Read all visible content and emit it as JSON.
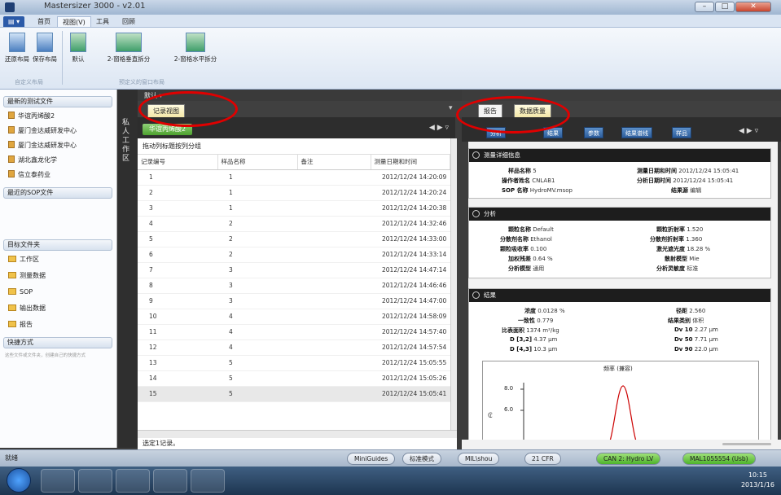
{
  "window": {
    "title": "Mastersizer 3000 - v2.01"
  },
  "ribbon_tabs": [
    "首页",
    "视图(V)",
    "工具",
    "回顾"
  ],
  "ribbon_menu_label": "▤ ▾",
  "ribbon": {
    "buttons": [
      "还原布局",
      "保存布局",
      "默认",
      "2-窗格垂直拆分",
      "2-窗格水平拆分"
    ],
    "groups": [
      "自定义布局",
      "预定义的窗口布局"
    ]
  },
  "left_pane": {
    "recent_tests_header": "最新的测试文件",
    "recent_tests": [
      "华谊丙烯酸2",
      "厦门金达威研发中心",
      "厦门金达威研发中心",
      "湖北鑫龙化学",
      "信立泰药业"
    ],
    "recent_sop_header": "最近的SOP文件",
    "target_folder_header": "目标文件夹",
    "folders": [
      "工作区",
      "测量数据",
      "SOP",
      "输出数据",
      "报告"
    ],
    "shortcuts_header": "快捷方式",
    "shortcuts_note": "这些文件或文件夹，创建自己的快捷方式"
  },
  "workspace_vertical": "私人工作区",
  "mid": {
    "top_label": "默认 ▾",
    "view_tab": "记录视图",
    "file_tab": "华谊丙烯酸2",
    "nav": "◀ ▶ ▿",
    "group_hint": "拖动列标题按列分组",
    "columns": [
      "记录编号",
      "样品名称",
      "备注",
      "测量日期和时间"
    ],
    "rows": [
      [
        "1",
        "1",
        "",
        "2012/12/24 14:20:09"
      ],
      [
        "2",
        "1",
        "",
        "2012/12/24 14:20:24"
      ],
      [
        "3",
        "1",
        "",
        "2012/12/24 14:20:38"
      ],
      [
        "4",
        "2",
        "",
        "2012/12/24 14:32:46"
      ],
      [
        "5",
        "2",
        "",
        "2012/12/24 14:33:00"
      ],
      [
        "6",
        "2",
        "",
        "2012/12/24 14:33:14"
      ],
      [
        "7",
        "3",
        "",
        "2012/12/24 14:47:14"
      ],
      [
        "8",
        "3",
        "",
        "2012/12/24 14:46:46"
      ],
      [
        "9",
        "3",
        "",
        "2012/12/24 14:47:00"
      ],
      [
        "10",
        "4",
        "",
        "2012/12/24 14:58:09"
      ],
      [
        "11",
        "4",
        "",
        "2012/12/24 14:57:40"
      ],
      [
        "12",
        "4",
        "",
        "2012/12/24 14:57:54"
      ],
      [
        "13",
        "5",
        "",
        "2012/12/24 15:05:55"
      ],
      [
        "14",
        "5",
        "",
        "2012/12/24 15:05:26"
      ],
      [
        "15",
        "5",
        "",
        "2012/12/24 15:05:41"
      ]
    ],
    "selected_row": 14,
    "selection_note": "选定1记录。"
  },
  "right": {
    "tabs": [
      "报告",
      "数据质量"
    ],
    "tools": [
      "分析",
      "结果",
      "参数",
      "结果谱线",
      "样品"
    ],
    "sections": {
      "measurement": {
        "title": "测量详细信息",
        "sample_name_label": "样品名称",
        "sample_name": "5",
        "operator_label": "操作者姓名",
        "operator": "CNLAB1",
        "sop_label": "SOP 名称",
        "sop": "HydroMV.msop",
        "meas_time_label": "测量日期和时间",
        "meas_time": "2012/12/24 15:05:41",
        "analysis_time_label": "分析日期时间",
        "analysis_time": "2012/12/24 15:05:41",
        "result_source_label": "结果源",
        "result_source": "编辑"
      },
      "analysis": {
        "title": "分析",
        "particle_name_label": "颗粒名称",
        "particle_name": "Default",
        "dispersant_label": "分散剂名称",
        "dispersant": "Ethanol",
        "absorption_label": "颗粒吸收率",
        "absorption": "0.100",
        "weighted_residual_label": "加权残差",
        "weighted_residual": "0.64 %",
        "analysis_model_label": "分析模型",
        "analysis_model": "通用",
        "particle_ri_label": "颗粒折射率",
        "particle_ri": "1.520",
        "dispersant_ri_label": "分散剂折射率",
        "dispersant_ri": "1.360",
        "obscuration_label": "激光遮光度",
        "obscuration": "18.28 %",
        "scattering_model_label": "散射模型",
        "scattering_model": "Mie",
        "sensitivity_label": "分析灵敏度",
        "sensitivity": "标准"
      },
      "results": {
        "title": "结果",
        "conc_label": "浓度",
        "conc": "0.0128 %",
        "uniformity_label": "一致性",
        "uniformity": "0.779",
        "ssa_label": "比表面积",
        "ssa": "1374 m²/kg",
        "d32_label": "D [3,2]",
        "d32": "4.37 µm",
        "d43_label": "D [4,3]",
        "d43": "10.3 µm",
        "span_label": "径距",
        "span": "2.560",
        "result_type_label": "结果类别",
        "result_type": "体积",
        "dv10_label": "Dv 10",
        "dv10": "2.27 µm",
        "dv50_label": "Dv 50",
        "dv50": "7.71 µm",
        "dv90_label": "Dv 90",
        "dv90": "22.0 µm"
      }
    },
    "chart": {
      "title": "频率 (兼容)",
      "yticks": [
        "8.0",
        "6.0"
      ],
      "ylabel_glyph": "₢"
    }
  },
  "status_bar": {
    "ready": "就绪",
    "buttons": [
      "MiniGuides",
      "标准模式",
      "MIL\\shou",
      "21 CFR",
      "CAN 2: Hydro LV",
      "MAL1055554 (Usb)"
    ]
  },
  "taskbar": {
    "time": "10:15",
    "date": "2013/1/16"
  },
  "colors": {
    "accent": "#2b5aa8",
    "annotation": "#e00000",
    "status_green": "#4db32a"
  }
}
